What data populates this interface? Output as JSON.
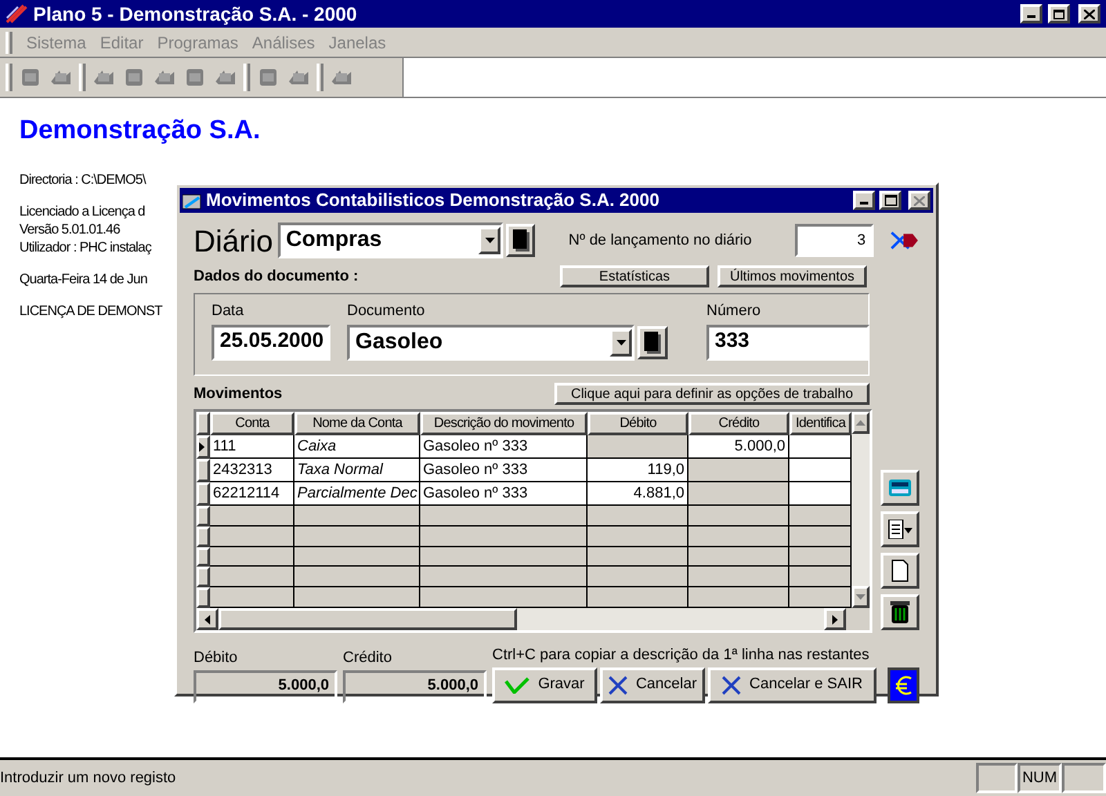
{
  "window": {
    "title": "Plano 5 - Demonstração S.A. - 2000"
  },
  "menu": [
    {
      "label": "Sistema",
      "disabled": true
    },
    {
      "label": "Editar",
      "disabled": true
    },
    {
      "label": "Programas",
      "disabled": true
    },
    {
      "label": "Análises",
      "disabled": true
    },
    {
      "label": "Janelas",
      "disabled": true
    }
  ],
  "background": {
    "company": "Demonstração S.A.",
    "lines": [
      "Directoria : C:\\DEMO5\\",
      "Licenciado a Licença d",
      "Versão 5.01.01.46",
      "Utilizador : PHC instalaç",
      "Quarta-Feira 14 de Jun",
      "LICENÇA DE DEMONST"
    ]
  },
  "dialog": {
    "title": "Movimentos Contabilisticos Demonstração S.A. 2000",
    "diario_label": "Diário",
    "diario_value": "Compras",
    "lancamento_label": "Nº de lançamento no diário",
    "lancamento_value": "3",
    "section_label": "Dados do documento :",
    "top_buttons": [
      "Estatísticas",
      "Últimos movimentos"
    ],
    "data_label": "Data",
    "data_value": "25.05.2000",
    "documento_label": "Documento",
    "documento_value": "Gasoleo",
    "numero_label": "Número",
    "numero_value": "333",
    "movimentos_label": "Movimentos",
    "options_button": "Clique aqui para definir as opções de trabalho",
    "table": {
      "columns": [
        "Conta",
        "Nome da Conta",
        "Descrição do movimento",
        "Débito",
        "Crédito",
        "Identifica"
      ],
      "rows": [
        {
          "selected": true,
          "cells": [
            "111",
            "Caixa",
            "Gasoleo nº 333",
            null,
            "5.000,0",
            ""
          ]
        },
        {
          "selected": false,
          "cells": [
            "2432313",
            "Taxa Normal",
            "Gasoleo nº 333",
            "119,0",
            null,
            ""
          ]
        },
        {
          "selected": false,
          "cells": [
            "62212114",
            "Parcialmente Dec",
            "Gasoleo nº 333",
            "4.881,0",
            null,
            ""
          ]
        }
      ]
    },
    "debito_label": "Débito",
    "debito_total": "5.000,0",
    "credito_label": "Crédito",
    "credito_total": "5.000,0",
    "hint": "Ctrl+C para copiar a descrição da 1ª linha nas restantes",
    "buttons": [
      {
        "kind": "save",
        "label": "Gravar"
      },
      {
        "kind": "cancel",
        "label": "Cancelar"
      },
      {
        "kind": "cancel",
        "label": "Cancelar e SAIR"
      }
    ]
  },
  "status_bar": {
    "message": "Introduzir um novo registo",
    "num": "NUM"
  }
}
